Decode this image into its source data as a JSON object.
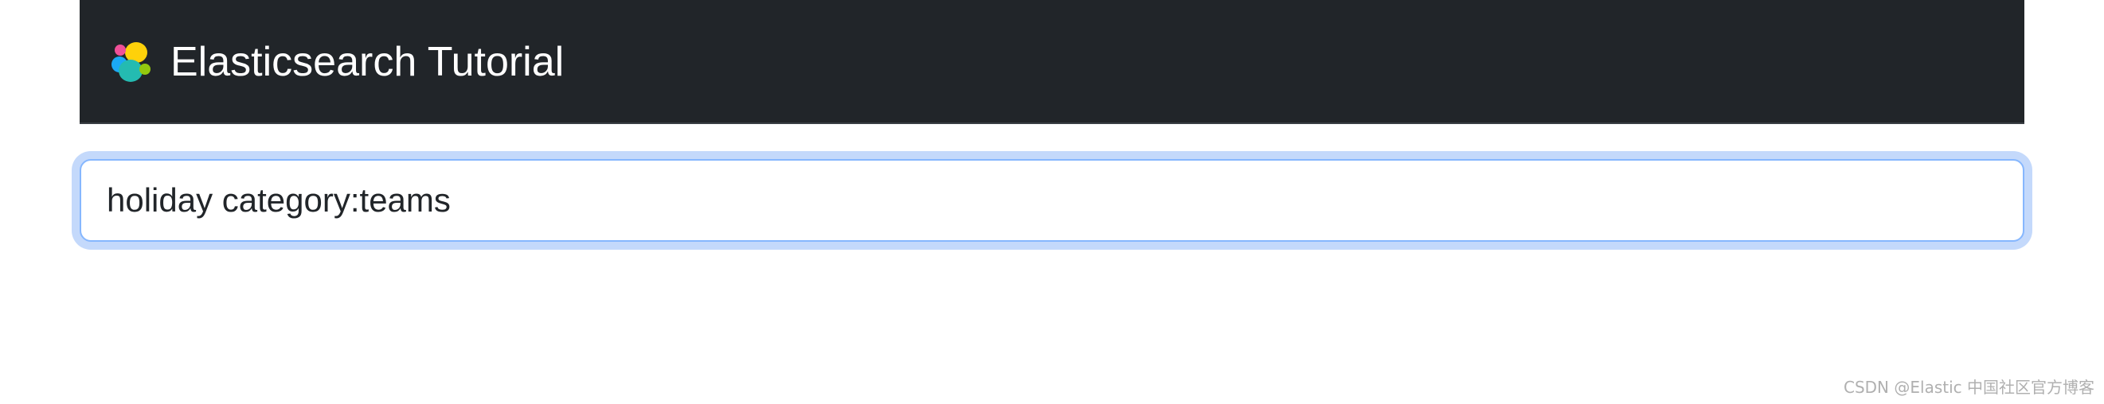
{
  "header": {
    "brand_title": "Elasticsearch Tutorial",
    "logo_icon": "elastic-logo-icon",
    "background_color": "#212529"
  },
  "search": {
    "value": "holiday category:teams",
    "focus_ring_color": "#c4d9fb",
    "border_color": "#86b7fe"
  },
  "watermark": {
    "text": "CSDN @Elastic 中国社区官方博客"
  }
}
